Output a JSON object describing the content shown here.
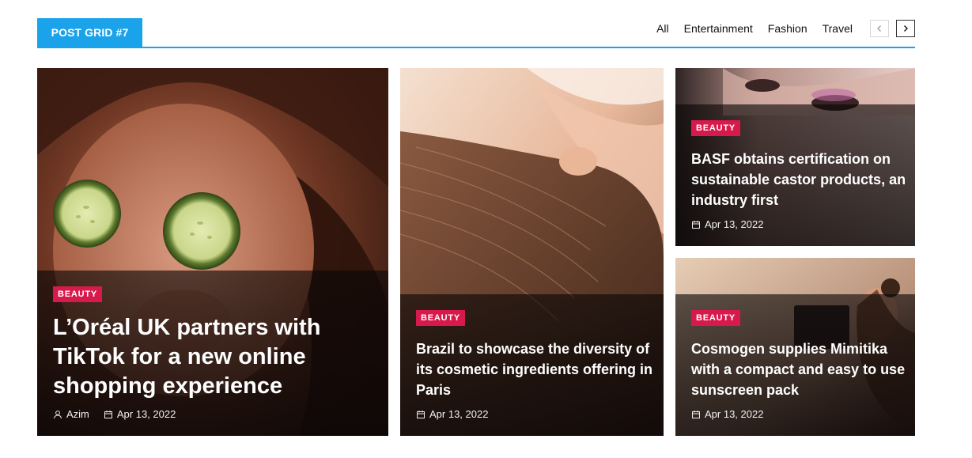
{
  "header": {
    "title": "POST GRID #7",
    "filters": [
      "All",
      "Entertainment",
      "Fashion",
      "Travel"
    ],
    "prev_icon": "chevron-left-icon",
    "next_icon": "chevron-right-icon"
  },
  "colors": {
    "accent": "#1aa3ea",
    "badge": "#d7194b"
  },
  "posts": [
    {
      "category": "BEAUTY",
      "title": "L’Oréal UK partners with TikTok for a new online shopping experience",
      "author": "Azim",
      "date": "Apr 13, 2022"
    },
    {
      "category": "BEAUTY",
      "title": "Brazil to showcase the diversity of its cosmetic ingredients offering in Paris",
      "date": "Apr 13, 2022"
    },
    {
      "category": "BEAUTY",
      "title": "BASF obtains certification on sustainable castor products, an industry first",
      "date": "Apr 13, 2022"
    },
    {
      "category": "BEAUTY",
      "title": "Cosmogen supplies Mimitika with a compact and easy to use sunscreen pack",
      "date": "Apr 13, 2022"
    }
  ]
}
